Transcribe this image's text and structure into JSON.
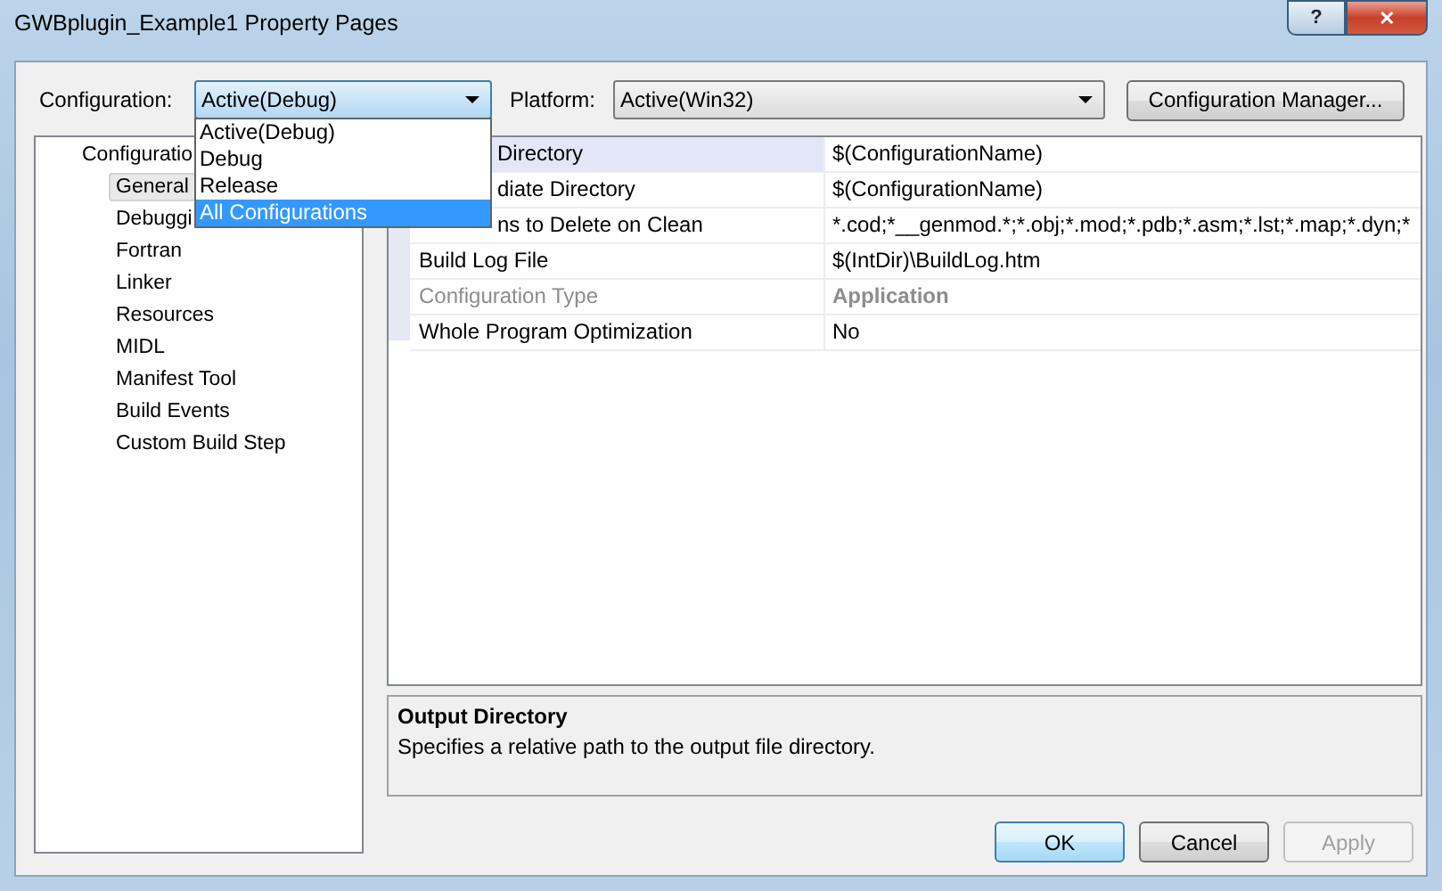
{
  "window": {
    "title": "GWBplugin_Example1 Property Pages",
    "help": "?",
    "close": "✕"
  },
  "toolbar": {
    "configuration_label": "Configuration:",
    "configuration_value": "Active(Debug)",
    "platform_label": "Platform:",
    "platform_value": "Active(Win32)",
    "manager_button": "Configuration Manager..."
  },
  "configuration_menu": {
    "items": [
      {
        "label": "Active(Debug)",
        "selected": false
      },
      {
        "label": "Debug",
        "selected": false
      },
      {
        "label": "Release",
        "selected": false
      },
      {
        "label": "All Configurations",
        "selected": true
      }
    ]
  },
  "tree": {
    "items": [
      {
        "label": "Configuratio",
        "selected": false,
        "children": [
          {
            "label": "General",
            "selected": true
          },
          {
            "label": "Debuggi",
            "selected": false
          },
          {
            "label": "Fortran",
            "selected": false
          },
          {
            "label": "Linker",
            "selected": false
          },
          {
            "label": "Resources",
            "selected": false
          },
          {
            "label": "MIDL",
            "selected": false
          },
          {
            "label": "Manifest Tool",
            "selected": false
          },
          {
            "label": "Build Events",
            "selected": false
          },
          {
            "label": "Custom Build Step",
            "selected": false
          }
        ]
      }
    ]
  },
  "grid": {
    "rows": [
      {
        "name": "Directory",
        "value": "$(ConfigurationName)",
        "selected": true,
        "disabled": false
      },
      {
        "name": "diate Directory",
        "value": "$(ConfigurationName)",
        "selected": false,
        "disabled": false
      },
      {
        "name": "ns to Delete on Clean",
        "value": "*.cod;*__genmod.*;*.obj;*.mod;*.pdb;*.asm;*.lst;*.map;*.dyn;*",
        "selected": false,
        "disabled": false
      },
      {
        "name": "Build Log File",
        "value": "$(IntDir)\\BuildLog.htm",
        "selected": false,
        "disabled": false
      },
      {
        "name": "Configuration Type",
        "value": "Application",
        "selected": false,
        "disabled": true
      },
      {
        "name": "Whole Program Optimization",
        "value": "No",
        "selected": false,
        "disabled": false
      }
    ]
  },
  "description": {
    "title": "Output Directory",
    "text": "Specifies a relative path to the output file directory."
  },
  "buttons": [
    {
      "label": "OK",
      "disabled": false,
      "default": true
    },
    {
      "label": "Cancel",
      "disabled": false,
      "default": false
    },
    {
      "label": "Apply",
      "disabled": true,
      "default": false
    }
  ]
}
